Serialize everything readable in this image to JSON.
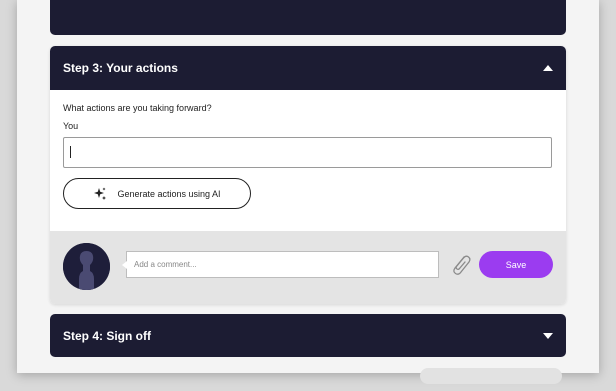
{
  "step3": {
    "title": "Step 3: Your actions",
    "question": "What actions are you taking forward?",
    "you_label": "You",
    "actions_value": "",
    "ai_button_label": "Generate actions using AI"
  },
  "comment": {
    "placeholder": "Add a comment...",
    "save_label": "Save"
  },
  "step4": {
    "title": "Step 4: Sign off"
  },
  "colors": {
    "header_bg": "#1c1c33",
    "accent": "#9b3cf0"
  },
  "icons": {
    "collapse": "chevron-up-icon",
    "expand": "chevron-down-icon",
    "ai": "sparkle-icon",
    "attach": "paperclip-icon",
    "avatar": "user-avatar"
  }
}
